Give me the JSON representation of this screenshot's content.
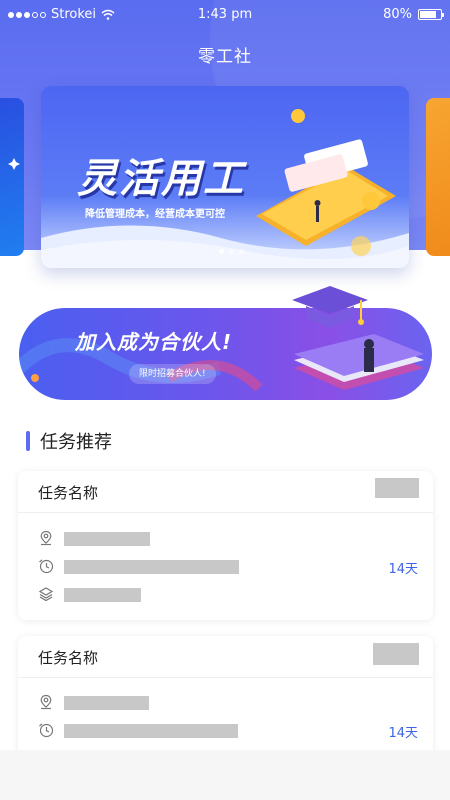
{
  "status_bar": {
    "carrier": "Strokei",
    "time": "1:43 pm",
    "battery": "80%",
    "battery_level": 0.8
  },
  "header": {
    "title": "零工社"
  },
  "carousel": {
    "headline": "灵活用工",
    "subtitle": "降低管理成本，经营成本更可控",
    "active_index": 0,
    "page_count": 3
  },
  "partner_banner": {
    "headline": "加入成为合伙人!",
    "pill": "限时招募合伙人!"
  },
  "section": {
    "title": "任务推荐"
  },
  "tasks": [
    {
      "name": "任务名称",
      "days": "14天"
    },
    {
      "name": "任务名称",
      "days": "14天"
    }
  ],
  "icons": {
    "location": "location-pin-icon",
    "clock": "clock-icon",
    "layers": "layers-icon"
  },
  "colors": {
    "primary": "#5a6cf0",
    "accent_text": "#3f63e6",
    "placeholder": "#c8c8c8"
  }
}
